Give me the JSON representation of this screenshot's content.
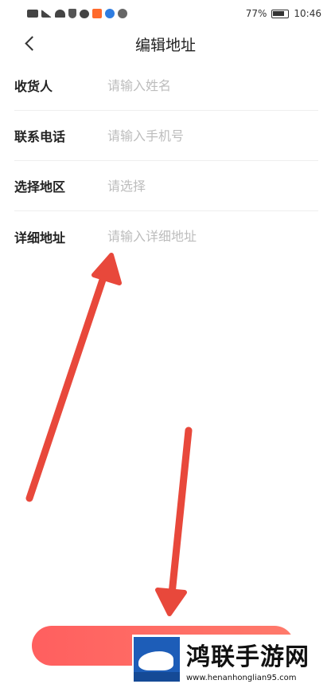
{
  "status_bar": {
    "icons": [
      "hd-icon",
      "signal-icon",
      "wifi-icon",
      "shield-icon",
      "chat-icon",
      "app-icon",
      "music-icon",
      "app-icon"
    ],
    "battery": "77%",
    "time": "10:46"
  },
  "header": {
    "back_icon": "chevron-left-icon",
    "title": "编辑地址"
  },
  "form": {
    "fields": [
      {
        "label": "收货人",
        "placeholder": "请输入姓名"
      },
      {
        "label": "联系电话",
        "placeholder": "请输入手机号"
      },
      {
        "label": "选择地区",
        "placeholder": "请选择"
      },
      {
        "label": "详细地址",
        "placeholder": "请输入详细地址"
      }
    ]
  },
  "watermark": {
    "name": "鸿联手游网",
    "url": "www.henanhonglian95.com"
  },
  "colors": {
    "accent": "#ff6661",
    "arrow": "#e8483b",
    "placeholder": "#bdbdbd",
    "brand_blue": "#1d5db8"
  }
}
